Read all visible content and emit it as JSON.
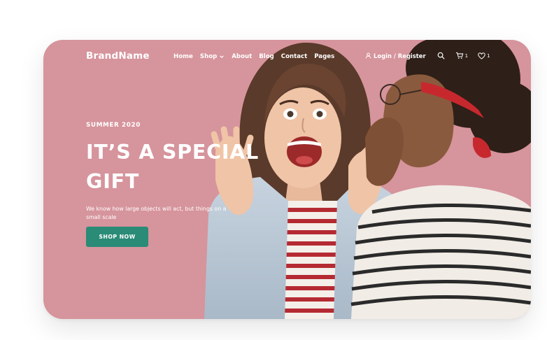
{
  "header": {
    "brand": "BrandName",
    "nav": [
      {
        "label": "Home"
      },
      {
        "label": "Shop"
      },
      {
        "label": "About"
      },
      {
        "label": "Blog"
      },
      {
        "label": "Contact"
      },
      {
        "label": "Pages"
      }
    ],
    "login_label": "Login / Register",
    "cart_count": "1",
    "wishlist_count": "1",
    "icons": {
      "user": "user-icon",
      "search": "search-icon",
      "cart": "cart-icon",
      "wishlist": "heart-icon",
      "shop_dropdown": "chevron-down-icon"
    }
  },
  "hero": {
    "eyebrow": "SUMMER 2020",
    "title_line1": "IT’S A SPECIAL",
    "title_line2": "GIFT",
    "description": "We know how large objects will act, but things on a small scale",
    "cta_label": "SHOP NOW",
    "image_alt": "Two young women whispering; one is shouting with excitement"
  },
  "colors": {
    "hero_background": "#d6949c",
    "cta_button": "#2a8b77",
    "text": "#ffffff"
  }
}
